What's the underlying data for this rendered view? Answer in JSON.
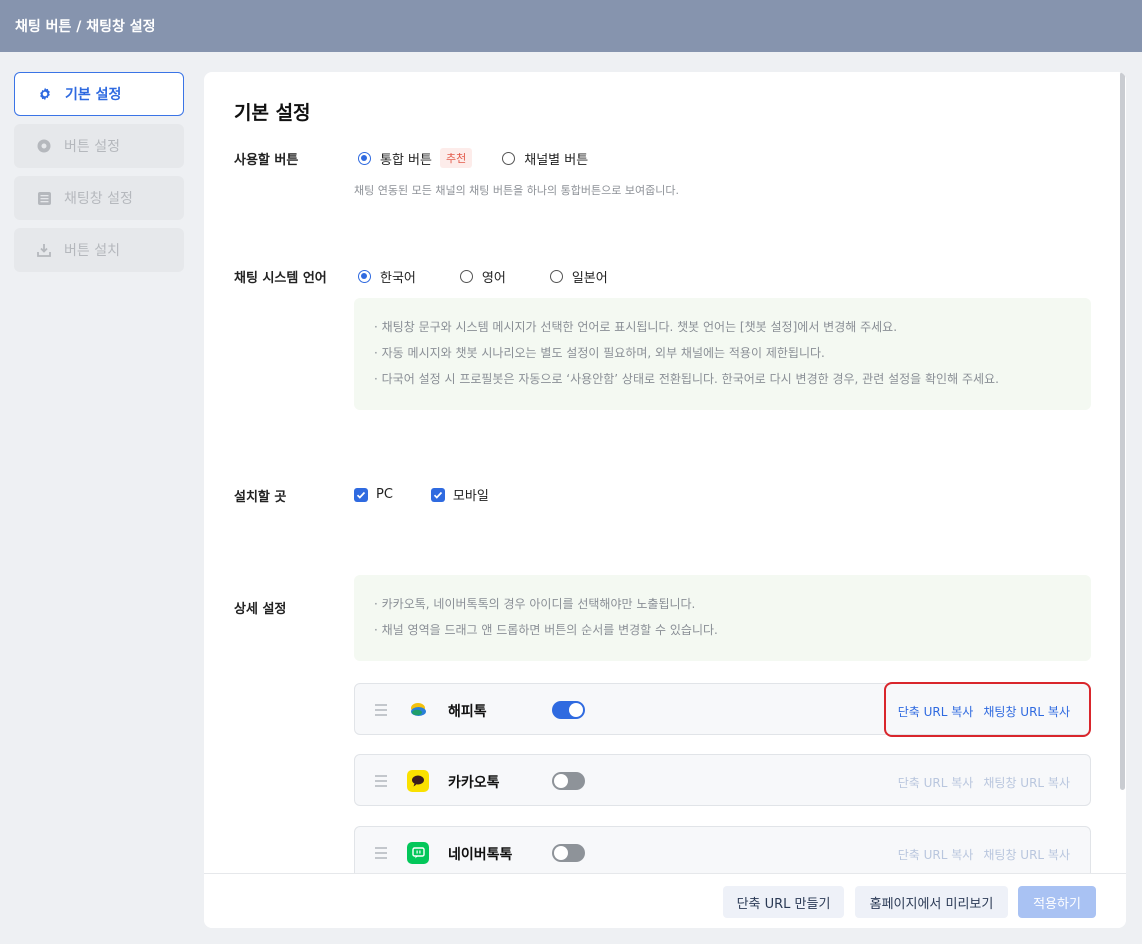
{
  "window": {
    "title": "채팅 버튼 / 채팅창 설정"
  },
  "sidebar": {
    "items": [
      {
        "label": "기본 설정",
        "icon": "gear-icon",
        "active": true
      },
      {
        "label": "버튼 설정",
        "icon": "circle-dot-icon",
        "active": false
      },
      {
        "label": "채팅창 설정",
        "icon": "list-icon",
        "active": false
      },
      {
        "label": "버튼 설치",
        "icon": "download-icon",
        "active": false
      }
    ]
  },
  "main": {
    "title": "기본 설정",
    "button_type": {
      "label": "사용할 버튼",
      "options": [
        {
          "label": "통합 버튼",
          "selected": true,
          "badge": "추천"
        },
        {
          "label": "채널별 버튼",
          "selected": false
        }
      ],
      "description": "채팅 연동된 모든 채널의 채팅 버튼을 하나의 통합버튼으로 보여줍니다."
    },
    "language": {
      "label": "채팅 시스템 언어",
      "options": [
        {
          "label": "한국어",
          "selected": true
        },
        {
          "label": "영어",
          "selected": false
        },
        {
          "label": "일본어",
          "selected": false
        }
      ],
      "notes": [
        "· 채팅창 문구와 시스템 메시지가 선택한 언어로 표시됩니다. 챗봇 언어는 [챗봇 설정]에서 변경해 주세요.",
        "· 자동 메시지와 챗봇 시나리오는 별도 설정이 필요하며, 외부 채널에는 적용이 제한됩니다.",
        "· 다국어 설정 시 프로필봇은 자동으로 ‘사용안함’ 상태로 전환됩니다. 한국어로 다시 변경한 경우, 관련 설정을 확인해 주세요."
      ]
    },
    "install_location": {
      "label": "설치할 곳",
      "options": [
        {
          "label": "PC",
          "checked": true
        },
        {
          "label": "모바일",
          "checked": true
        }
      ]
    },
    "detail": {
      "label": "상세 설정",
      "notes": [
        "· 카카오톡, 네이버톡톡의 경우 아이디를 선택해야만 노출됩니다.",
        "· 채널 영역을 드래그 앤 드롭하면 버튼의 순서를 변경할 수 있습니다."
      ],
      "channels": [
        {
          "name": "해피톡",
          "icon": "happytalk-icon",
          "enabled": true,
          "short_url_label": "단축 URL 복사",
          "chat_url_label": "채팅창 URL 복사"
        },
        {
          "name": "카카오톡",
          "icon": "kakaotalk-icon",
          "enabled": false,
          "short_url_label": "단축 URL 복사",
          "chat_url_label": "채팅창 URL 복사"
        },
        {
          "name": "네이버톡톡",
          "icon": "naver-talktalk-icon",
          "enabled": false,
          "short_url_label": "단축 URL 복사",
          "chat_url_label": "채팅창 URL 복사"
        }
      ]
    }
  },
  "footer": {
    "make_short_url": "단축 URL 만들기",
    "preview": "홈페이지에서 미리보기",
    "apply": "적용하기"
  },
  "colors": {
    "titlebar": "#8694ae",
    "accent": "#2f6ae0",
    "highlight_border": "#d9262c",
    "badge_bg": "#fdecea",
    "badge_text": "#e35a4a",
    "note_bg": "#f4f9f2"
  }
}
